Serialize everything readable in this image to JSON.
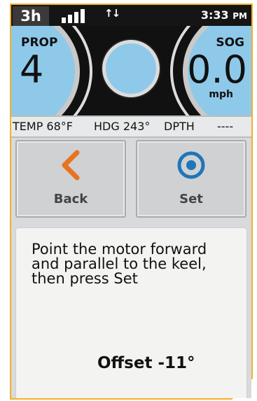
{
  "status": {
    "badge": "3h",
    "data_arrows": "↑↓",
    "time": "3:33",
    "ampm": "PM",
    "icons": [
      "signal-bars-icon",
      "data-transfer-icon"
    ]
  },
  "gauges": {
    "prop_label": "PROP",
    "prop_value": "4",
    "sog_label": "SOG",
    "sog_value": "0.0",
    "sog_unit": "mph"
  },
  "info": {
    "temp": "TEMP 68°F",
    "hdg": "HDG 243°",
    "dpth_label": "DPTH",
    "dpth_value": "----"
  },
  "buttons": {
    "back_label": "Back",
    "set_label": "Set",
    "back_icon": "chevron-left-icon",
    "set_icon": "target-icon"
  },
  "panel": {
    "instruction": "Point the motor forward and parallel to the keel, then press Set",
    "offset": "Offset -11°"
  },
  "colors": {
    "accent_orange": "#e9731e",
    "accent_blue": "#1f76b9",
    "gauge_blue": "#8fc9ea",
    "frame_orange": "#f2b128"
  }
}
